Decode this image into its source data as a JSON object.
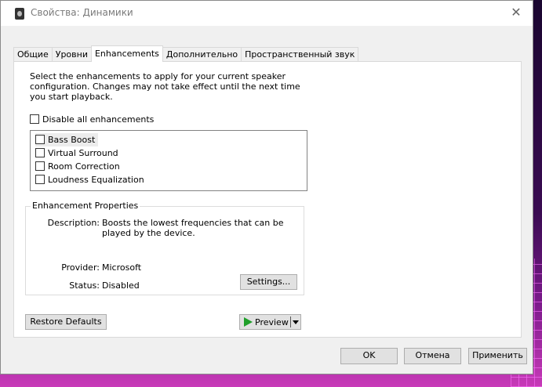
{
  "window": {
    "title": "Свойства: Динамики",
    "close_glyph": "✕"
  },
  "tabs": [
    {
      "label": "Общие",
      "active": false
    },
    {
      "label": "Уровни",
      "active": false
    },
    {
      "label": "Enhancements",
      "active": true
    },
    {
      "label": "Дополнительно",
      "active": false
    },
    {
      "label": "Пространственный звук",
      "active": false
    }
  ],
  "enhancements": {
    "intro": "Select the enhancements to apply for your current speaker configuration. Changes may not take effect until the next time you start playback.",
    "disable_all_label": "Disable all enhancements",
    "disable_all_checked": false,
    "items": [
      {
        "label": "Bass Boost",
        "checked": false,
        "selected": true
      },
      {
        "label": "Virtual Surround",
        "checked": false,
        "selected": false
      },
      {
        "label": "Room Correction",
        "checked": false,
        "selected": false
      },
      {
        "label": "Loudness Equalization",
        "checked": false,
        "selected": false
      }
    ]
  },
  "properties": {
    "group_title": "Enhancement Properties",
    "description_label": "Description:",
    "description_value": "Boosts the lowest frequencies that can be played by the device.",
    "provider_label": "Provider:",
    "provider_value": "Microsoft",
    "status_label": "Status:",
    "status_value": "Disabled",
    "settings_button": "Settings..."
  },
  "panel_buttons": {
    "restore_defaults": "Restore Defaults",
    "preview": "Preview"
  },
  "footer": {
    "ok": "OK",
    "cancel": "Отмена",
    "apply": "Применить"
  },
  "colors": {
    "play_icon": "#1f9f2a",
    "dialog_bg": "#f0f0f0",
    "panel_bg": "#ffffff"
  },
  "icons": {
    "title": "speaker-icon",
    "close": "close-icon",
    "play": "play-icon",
    "dropdown": "chevron-down-icon"
  }
}
